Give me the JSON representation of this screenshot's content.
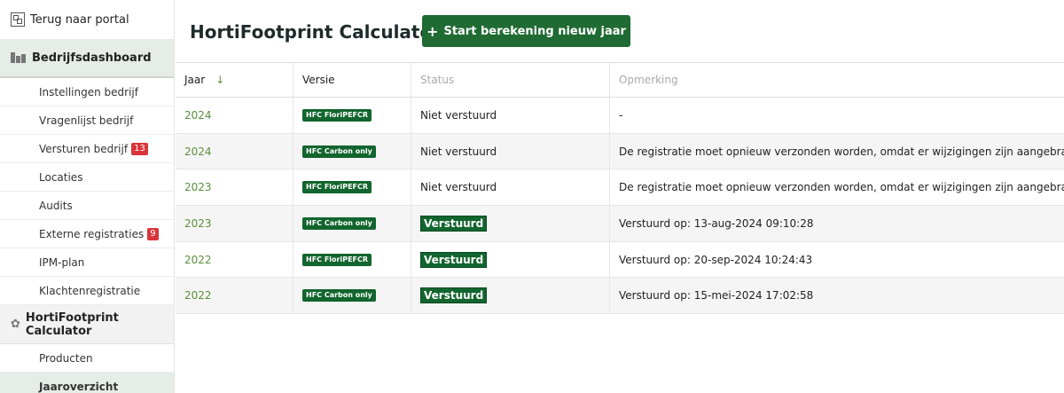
{
  "sidebar": {
    "back_label": "Terug naar portal",
    "section_company": "Bedrijfsdashboard",
    "items": [
      {
        "label": "Instellingen bedrijf"
      },
      {
        "label": "Vragenlijst bedrijf"
      },
      {
        "label": "Versturen bedrijf",
        "badge": "13"
      },
      {
        "label": "Locaties"
      },
      {
        "label": "Audits"
      },
      {
        "label": "Externe registraties",
        "badge": "9"
      },
      {
        "label": "IPM-plan"
      },
      {
        "label": "Klachtenregistratie"
      }
    ],
    "section_calc": "HortiFootprint Calculator",
    "calc_items": [
      {
        "label": "Producten"
      },
      {
        "label": "Jaaroverzicht"
      }
    ]
  },
  "header": {
    "title": "HortiFootprint Calculator",
    "start_button": "Start berekening nieuw jaar",
    "start_plus": "+"
  },
  "table": {
    "columns": {
      "year": "Jaar",
      "version": "Versie",
      "status": "Status",
      "note": "Opmerking",
      "sort_arrow": "↓"
    },
    "rows": [
      {
        "year": "2024",
        "version": "HFC FloriPEFCR",
        "status": "Niet verstuurd",
        "sent": false,
        "note": "-"
      },
      {
        "year": "2024",
        "version": "HFC Carbon only",
        "status": "Niet verstuurd",
        "sent": false,
        "note": "De registratie moet opnieuw verzonden worden, omdat er wijzigingen zijn aangebracht."
      },
      {
        "year": "2023",
        "version": "HFC FloriPEFCR",
        "status": "Niet verstuurd",
        "sent": false,
        "note": "De registratie moet opnieuw verzonden worden, omdat er wijzigingen zijn aangebracht."
      },
      {
        "year": "2023",
        "version": "HFC Carbon only",
        "status": "Verstuurd",
        "sent": true,
        "note": "Verstuurd op: 13-aug-2024 09:10:28"
      },
      {
        "year": "2022",
        "version": "HFC FloriPEFCR",
        "status": "Verstuurd",
        "sent": true,
        "note": "Verstuurd op: 20-sep-2024 10:24:43"
      },
      {
        "year": "2022",
        "version": "HFC Carbon only",
        "status": "Verstuurd",
        "sent": true,
        "note": "Verstuurd op: 15-mei-2024 17:02:58"
      }
    ]
  },
  "colors": {
    "accent": "#1f6b33",
    "year_text": "#5b8f3c",
    "badge": "#d9343a"
  }
}
